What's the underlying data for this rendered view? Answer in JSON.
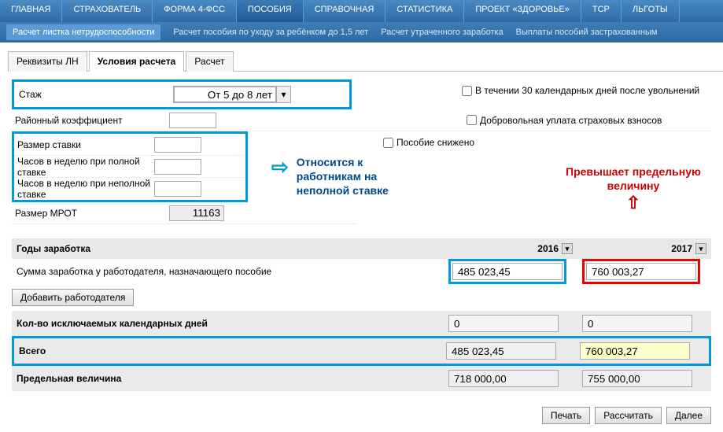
{
  "topnav": [
    "ГЛАВНАЯ",
    "СТРАХОВАТЕЛЬ",
    "ФОРМА 4-ФСС",
    "ПОСОБИЯ",
    "СПРАВОЧНАЯ",
    "СТАТИСТИКА",
    "ПРОЕКТ «ЗДОРОВЬЕ»",
    "ТСР",
    "ЛЬГОТЫ"
  ],
  "topnav_active": 3,
  "subnav": [
    "Расчет листка нетрудоспособности",
    "Расчет пособия по уходу за ребёнком до 1,5 лет",
    "Расчет утраченного заработка",
    "Выплаты пособий застрахованным"
  ],
  "subnav_active": 0,
  "tabs": [
    "Реквизиты ЛН",
    "Условия расчета",
    "Расчет"
  ],
  "tabs_active": 1,
  "form": {
    "stazh_label": "Стаж",
    "stazh_value": "От 5 до 8 лет",
    "coef_label": "Районный коэффициент",
    "coef_value": "",
    "stavka_label": "Размер ставки",
    "stavka_value": "",
    "hours_full_label": "Часов в неделю при полной ставке",
    "hours_full_value": "",
    "hours_part_label": "Часов в неделю при неполной ставке",
    "hours_part_value": "",
    "mrot_label": "Размер МРОТ",
    "mrot_value": "11163"
  },
  "checks": {
    "c1": "В течении 30 календарных дней после увольнений",
    "c2": "Добровольная уплата страховых взносов",
    "c3": "Пособие снижено"
  },
  "annotations": {
    "blue": "Относится к работникам на неполной ставке",
    "red": "Превышает предельную величину"
  },
  "years": {
    "header": "Годы заработка",
    "y1": "2016",
    "y2": "2017",
    "sum_label": "Сумма заработка у работодателя, назначающего пособие",
    "sum_y1": "485 023,45",
    "sum_y2": "760 003,27",
    "add_btn": "Добавить работодателя",
    "excl_label": "Кол-во исключаемых календарных дней",
    "excl_y1": "0",
    "excl_y2": "0",
    "total_label": "Всего",
    "total_y1": "485 023,45",
    "total_y2": "760 003,27",
    "limit_label": "Предельная величина",
    "limit_y1": "718 000,00",
    "limit_y2": "755 000,00"
  },
  "buttons": {
    "print": "Печать",
    "calc": "Рассчитать",
    "next": "Далее"
  }
}
